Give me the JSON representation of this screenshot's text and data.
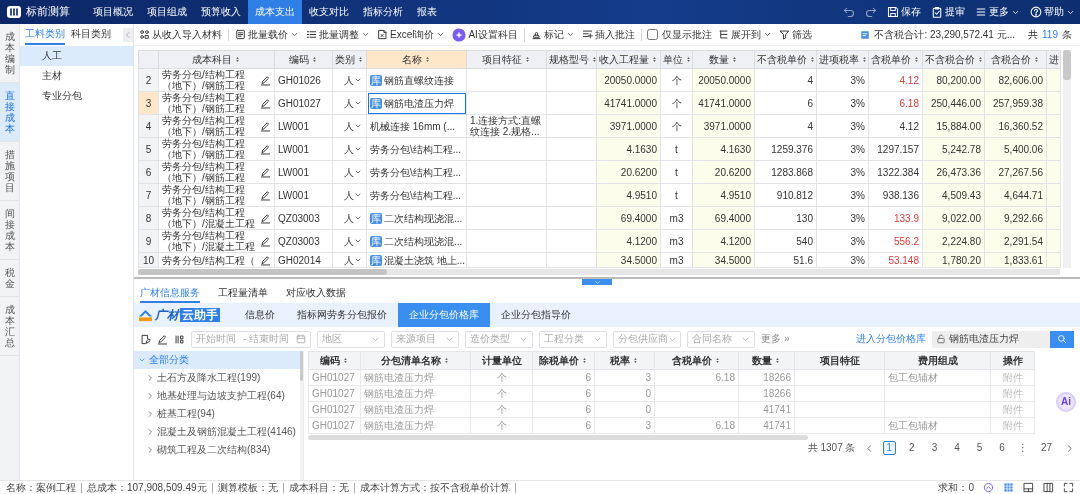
{
  "app": {
    "title": "标前测算"
  },
  "top_tabs": [
    {
      "label": "项目概况",
      "selected": false
    },
    {
      "label": "项目组成",
      "selected": false
    },
    {
      "label": "预算收入",
      "selected": false
    },
    {
      "label": "成本支出",
      "selected": true
    },
    {
      "label": "收支对比",
      "selected": false
    },
    {
      "label": "指标分析",
      "selected": false
    },
    {
      "label": "报表",
      "selected": false
    }
  ],
  "top_actions": [
    {
      "kind": "undo",
      "disabled": true,
      "dropdown": false
    },
    {
      "kind": "redo",
      "disabled": true,
      "dropdown": false
    },
    {
      "kind": "save",
      "label": "保存",
      "disabled": false,
      "dropdown": false
    },
    {
      "kind": "submit",
      "label": "提审",
      "disabled": false,
      "dropdown": false
    },
    {
      "kind": "more",
      "label": "更多",
      "disabled": false,
      "dropdown": true
    },
    {
      "kind": "help",
      "label": "帮助",
      "disabled": false,
      "dropdown": true
    }
  ],
  "side_nav": [
    {
      "label": "成本编制",
      "selected": false
    },
    {
      "label": "直接成本",
      "selected": true
    },
    {
      "label": "措施项目",
      "selected": false
    },
    {
      "label": "间接成本",
      "selected": false
    },
    {
      "label": "税金",
      "selected": false
    },
    {
      "label": "成本汇总",
      "selected": false
    }
  ],
  "category_tabs": [
    {
      "label": "工料类别",
      "selected": true
    },
    {
      "label": "科目类别",
      "selected": false
    }
  ],
  "categories": [
    {
      "label": "人工",
      "selected": true
    },
    {
      "label": "主材",
      "selected": false
    },
    {
      "label": "专业分包",
      "selected": false
    }
  ],
  "toolbar_left": [
    {
      "kind": "import",
      "label": "从收入导入材料",
      "dropdown": false,
      "divider_after": true
    },
    {
      "kind": "price",
      "label": "批量载价",
      "dropdown": true,
      "divider_after": false
    },
    {
      "kind": "adjust",
      "label": "批量调整",
      "dropdown": true,
      "divider_after": false
    },
    {
      "kind": "excel",
      "label": "Excel询价",
      "dropdown": true,
      "divider_after": false
    },
    {
      "kind": "ai",
      "label": "AI设置科目",
      "dropdown": false,
      "divider_after": true
    },
    {
      "kind": "mark",
      "label": "标记",
      "dropdown": true,
      "divider_after": false
    },
    {
      "kind": "note",
      "label": "插入批注",
      "dropdown": false,
      "divider_after": true
    }
  ],
  "note_filter": {
    "label": "仅显示批注",
    "checked": false
  },
  "toolbar_right": [
    {
      "kind": "expand",
      "label": "展开到",
      "dropdown": true,
      "divider_after": false
    },
    {
      "kind": "filter",
      "label": "筛选",
      "dropdown": false,
      "divider_after": false
    }
  ],
  "summary": {
    "total": "不含税合计: 23,290,572.41 元...",
    "count_prefix": "共",
    "count": "119",
    "count_suffix": "条"
  },
  "table": {
    "columns": [
      {
        "label": "成本科目",
        "sortable": true,
        "tinted": false,
        "selected": false
      },
      {
        "label": "编码",
        "sortable": true,
        "tinted": false,
        "selected": false
      },
      {
        "label": "类别",
        "sortable": true,
        "tinted": false,
        "selected": false
      },
      {
        "label": "名称",
        "sortable": true,
        "tinted": false,
        "selected": true
      },
      {
        "label": "项目特征",
        "sortable": true,
        "tinted": false,
        "selected": false
      },
      {
        "label": "规格型号",
        "sortable": true,
        "tinted": false,
        "selected": false
      },
      {
        "label": "收入工程量",
        "sortable": true,
        "tinted": true,
        "selected": false
      },
      {
        "label": "单位",
        "sortable": true,
        "tinted": false,
        "selected": false
      },
      {
        "label": "数量",
        "sortable": true,
        "tinted": true,
        "selected": false
      },
      {
        "label": "不含税单价",
        "sortable": true,
        "tinted": false,
        "selected": false
      },
      {
        "label": "进项税率",
        "sortable": true,
        "tinted": false,
        "selected": false
      },
      {
        "label": "含税单价",
        "sortable": true,
        "tinted": false,
        "selected": false
      },
      {
        "label": "不含税合价",
        "sortable": true,
        "tinted": true,
        "selected": false
      },
      {
        "label": "含税合价",
        "sortable": true,
        "tinted": true,
        "selected": false
      },
      {
        "label": "进",
        "sortable": false,
        "tinted": true,
        "selected": false
      }
    ],
    "rows": [
      {
        "number": "2",
        "cost_subject": "劳务分包/结构工程（地下）/钢筋工程",
        "code": "GH01026",
        "type": "人",
        "tag": "库",
        "name": "钢筋直螺纹连接",
        "income_qty": "20050.0000",
        "unit": "个",
        "qty": "20050.0000",
        "price_ex": "4",
        "tax_rate": "3%",
        "price_in": "4.12",
        "price_flag": true,
        "total_ex": "80,200.00",
        "total_in": "82,606.00",
        "selected": false
      },
      {
        "number": "3",
        "cost_subject": "劳务分包/结构工程（地下）/钢筋工程",
        "code": "GH01027",
        "type": "人",
        "tag": "库",
        "name": "钢筋电渣压力焊",
        "income_qty": "41741.0000",
        "unit": "个",
        "qty": "41741.0000",
        "price_ex": "6",
        "tax_rate": "3%",
        "price_in": "6.18",
        "price_flag": true,
        "total_ex": "250,446.00",
        "total_in": "257,959.38",
        "selected": true
      },
      {
        "number": "4",
        "cost_subject": "劳务分包/结构工程（地下）/钢筋工程",
        "code": "LW001",
        "type": "人",
        "name": "机械连接 16mm (...",
        "feature": "1.连接方式:直螺纹连接 2.规格...",
        "income_qty": "3971.0000",
        "unit": "个",
        "qty": "3971.0000",
        "price_ex": "4",
        "tax_rate": "3%",
        "price_in": "4.12",
        "price_flag": false,
        "total_ex": "15,884.00",
        "total_in": "16,360.52",
        "selected": false
      },
      {
        "number": "5",
        "cost_subject": "劳务分包/结构工程（地下）/钢筋工程",
        "code": "LW001",
        "type": "人",
        "name": "劳务分包\\结构工程...",
        "income_qty": "4.1630",
        "unit": "t",
        "qty": "4.1630",
        "price_ex": "1259.376",
        "tax_rate": "3%",
        "price_in": "1297.157",
        "price_flag": false,
        "total_ex": "5,242.78",
        "total_in": "5,400.06",
        "selected": false
      },
      {
        "number": "6",
        "cost_subject": "劳务分包/结构工程（地下）/钢筋工程",
        "code": "LW001",
        "type": "人",
        "name": "劳务分包\\结构工程...",
        "income_qty": "20.6200",
        "unit": "t",
        "qty": "20.6200",
        "price_ex": "1283.868",
        "tax_rate": "3%",
        "price_in": "1322.384",
        "price_flag": false,
        "total_ex": "26,473.36",
        "total_in": "27,267.56",
        "selected": false
      },
      {
        "number": "7",
        "cost_subject": "劳务分包/结构工程（地下）/钢筋工程",
        "code": "LW001",
        "type": "人",
        "name": "劳务分包\\结构工程...",
        "income_qty": "4.9510",
        "unit": "t",
        "qty": "4.9510",
        "price_ex": "910.812",
        "tax_rate": "3%",
        "price_in": "938.136",
        "price_flag": false,
        "total_ex": "4,509.43",
        "total_in": "4,644.71",
        "selected": false
      },
      {
        "number": "8",
        "cost_subject": "劳务分包/结构工程（地下）/混凝土工程",
        "code": "QZ03003",
        "type": "人",
        "tag": "库",
        "name": "二次结构现浇混...",
        "income_qty": "69.4000",
        "unit": "m3",
        "qty": "69.4000",
        "price_ex": "130",
        "tax_rate": "3%",
        "price_in": "133.9",
        "price_flag": true,
        "total_ex": "9,022.00",
        "total_in": "9,292.66",
        "selected": false
      },
      {
        "number": "9",
        "cost_subject": "劳务分包/结构工程（地下）/混凝土工程",
        "code": "QZ03003",
        "type": "人",
        "tag": "库",
        "name": "二次结构现浇混...",
        "income_qty": "4.1200",
        "unit": "m3",
        "qty": "4.1200",
        "price_ex": "540",
        "tax_rate": "3%",
        "price_in": "556.2",
        "price_flag": true,
        "total_ex": "2,224.80",
        "total_in": "2,291.54",
        "selected": false
      },
      {
        "number": "10",
        "cost_subject": "劳务分包/结构工程（",
        "code": "GH02014",
        "type": "人",
        "tag": "库",
        "name": "混凝土浇筑 地上...",
        "income_qty": "34.5000",
        "unit": "m3",
        "qty": "34.5000",
        "price_ex": "51.6",
        "tax_rate": "3%",
        "price_in": "53.148",
        "price_flag": true,
        "total_ex": "1,780.20",
        "total_in": "1,833.61",
        "selected": false
      }
    ]
  },
  "bottom_tabs": [
    {
      "label": "广材信息服务",
      "selected": true
    },
    {
      "label": "工程量清单",
      "selected": false
    },
    {
      "label": "对应收入数据",
      "selected": false
    }
  ],
  "assistant": {
    "brand_main": "广材",
    "brand_tag": "云助手",
    "tabs": [
      {
        "label": "信息价",
        "selected": false
      },
      {
        "label": "指标网劳务分包报价",
        "selected": false
      },
      {
        "label": "企业分包价格库",
        "selected": true
      },
      {
        "label": "企业分包指导价",
        "selected": false
      }
    ]
  },
  "filters": {
    "date_start": {
      "placeholder": "开始时间"
    },
    "date_separator": "-",
    "date_end": {
      "placeholder": "结束时间"
    },
    "selects": [
      {
        "placeholder": "地区"
      },
      {
        "placeholder": "来源项目"
      },
      {
        "placeholder": "造价类型"
      },
      {
        "placeholder": "工程分类"
      },
      {
        "placeholder": "分包供应商"
      },
      {
        "placeholder": "合同名称"
      }
    ],
    "more": "更多 »",
    "link": "进入分包价格库",
    "search": {
      "value": "钢筋电渣压力焊"
    }
  },
  "tree": {
    "label": "全部分类",
    "expanded": true,
    "selected": true,
    "children": [
      {
        "label": "土石方及降水工程(199)",
        "expanded": false,
        "selected": false
      },
      {
        "label": "地基处理与边坡支护工程(64)",
        "expanded": false,
        "selected": false
      },
      {
        "label": "桩基工程(94)",
        "expanded": false,
        "selected": false
      },
      {
        "label": "混凝土及钢筋混凝土工程(4146)",
        "expanded": false,
        "selected": false
      },
      {
        "label": "砌筑工程及二次结构(834)",
        "expanded": false,
        "selected": false
      }
    ]
  },
  "price_table": {
    "columns": [
      {
        "label": "编码",
        "sortable": true
      },
      {
        "label": "分包清单名称",
        "sortable": true
      },
      {
        "label": "计量单位",
        "sortable": false
      },
      {
        "label": "除税单价",
        "sortable": true
      },
      {
        "label": "税率",
        "sortable": true
      },
      {
        "label": "含税单价",
        "sortable": true
      },
      {
        "label": "数量",
        "sortable": true
      },
      {
        "label": "项目特征",
        "sortable": false
      },
      {
        "label": "费用组成",
        "sortable": false
      },
      {
        "label": "操作",
        "sortable": false
      }
    ],
    "rows": [
      {
        "code": "GH01027",
        "name": "钢筋电渣压力焊",
        "unit": "个",
        "price_ex": "6",
        "tax_rate": "3",
        "price_in": "6.18",
        "qty": "18266",
        "fee": "包工包辅材",
        "action": "附件"
      },
      {
        "code": "GH01027",
        "name": "钢筋电渣压力焊",
        "unit": "个",
        "price_ex": "6",
        "tax_rate": "0",
        "qty": "18266",
        "action": "附件"
      },
      {
        "code": "GH01027",
        "name": "钢筋电渣压力焊",
        "unit": "个",
        "price_ex": "6",
        "tax_rate": "0",
        "qty": "41741",
        "action": "附件"
      },
      {
        "code": "GH01027",
        "name": "钢筋电渣压力焊",
        "unit": "个",
        "price_ex": "6",
        "tax_rate": "3",
        "price_in": "6.18",
        "qty": "41741",
        "fee": "包工包辅材",
        "action": "附件"
      }
    ]
  },
  "pagination": {
    "total": "共 1307 条",
    "pages": [
      {
        "kind": "page",
        "label": "1",
        "selected": true
      },
      {
        "kind": "page",
        "label": "2",
        "selected": false
      },
      {
        "kind": "page",
        "label": "3",
        "selected": false
      },
      {
        "kind": "page",
        "label": "4",
        "selected": false
      },
      {
        "kind": "page",
        "label": "5",
        "selected": false
      },
      {
        "kind": "page",
        "label": "6",
        "selected": false
      },
      {
        "kind": "gap",
        "label": "⋮"
      },
      {
        "kind": "page",
        "label": "27",
        "selected": false
      }
    ]
  },
  "ai_button": {
    "label": "Ai"
  },
  "status_bar": {
    "items": [
      "名称：案例工程",
      "总成本：107,908,509.49元",
      "测算模板：无",
      "成本科目：无",
      "成本计算方式：按不含税单价计算"
    ],
    "sum": "求和：0"
  }
}
